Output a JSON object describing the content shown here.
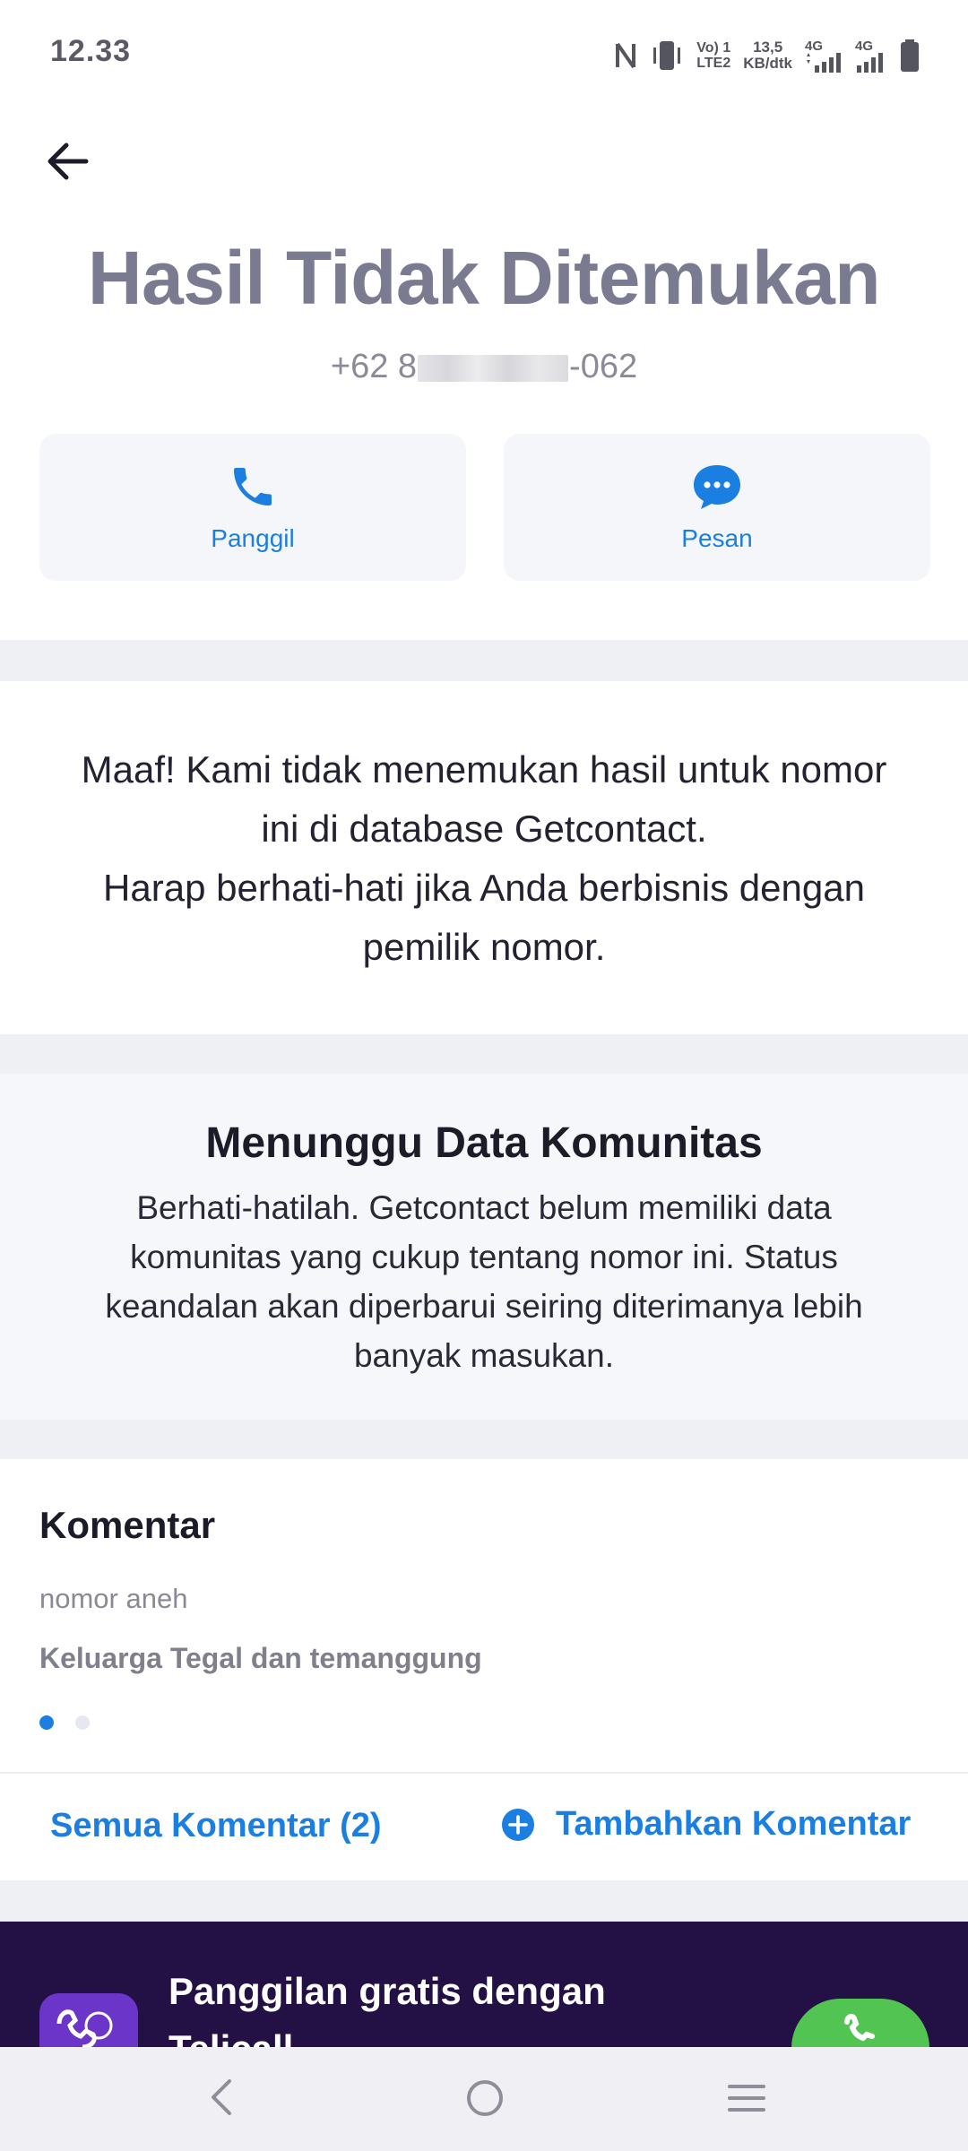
{
  "status_bar": {
    "time": "12.33",
    "nfc_icon": "nfc-icon",
    "vibrate_icon": "vibrate-icon",
    "volte_line1": "Vo) 1",
    "volte_line2": "LTE2",
    "speed_line1": "13,5",
    "speed_line2": "KB/dtk",
    "net1": "4G",
    "net2": "4G",
    "battery_icon": "battery-icon"
  },
  "header": {
    "back_icon": "arrow-left-icon",
    "title": "Hasil Tidak Ditemukan",
    "phone_prefix": "+62 8",
    "phone_suffix": "-062"
  },
  "actions": {
    "call_label": "Panggil",
    "message_label": "Pesan"
  },
  "notice": {
    "line1": "Maaf! Kami tidak menemukan hasil untuk nomor",
    "line2": "ini di database Getcontact.",
    "line3": "Harap berhati-hati jika Anda berbisnis dengan",
    "line4": "pemilik nomor."
  },
  "community": {
    "title": "Menunggu Data Komunitas",
    "body": "Berhati-hatilah. Getcontact belum memiliki data komunitas yang cukup tentang nomor ini. Status keandalan akan diperbarui seiring diterimanya lebih banyak masukan."
  },
  "comments": {
    "title": "Komentar",
    "items": [
      "nomor aneh",
      "Keluarga Tegal dan temanggung"
    ],
    "page_count": 2,
    "active_page": 1,
    "all_label": "Semua Komentar (2)",
    "add_label": "Tambahkan Komentar"
  },
  "promo": {
    "line1": "Panggilan gratis dengan",
    "line2": "Telicall"
  },
  "colors": {
    "accent": "#1a7fe0",
    "promo_bg": "#231044",
    "call_green": "#52c452"
  }
}
